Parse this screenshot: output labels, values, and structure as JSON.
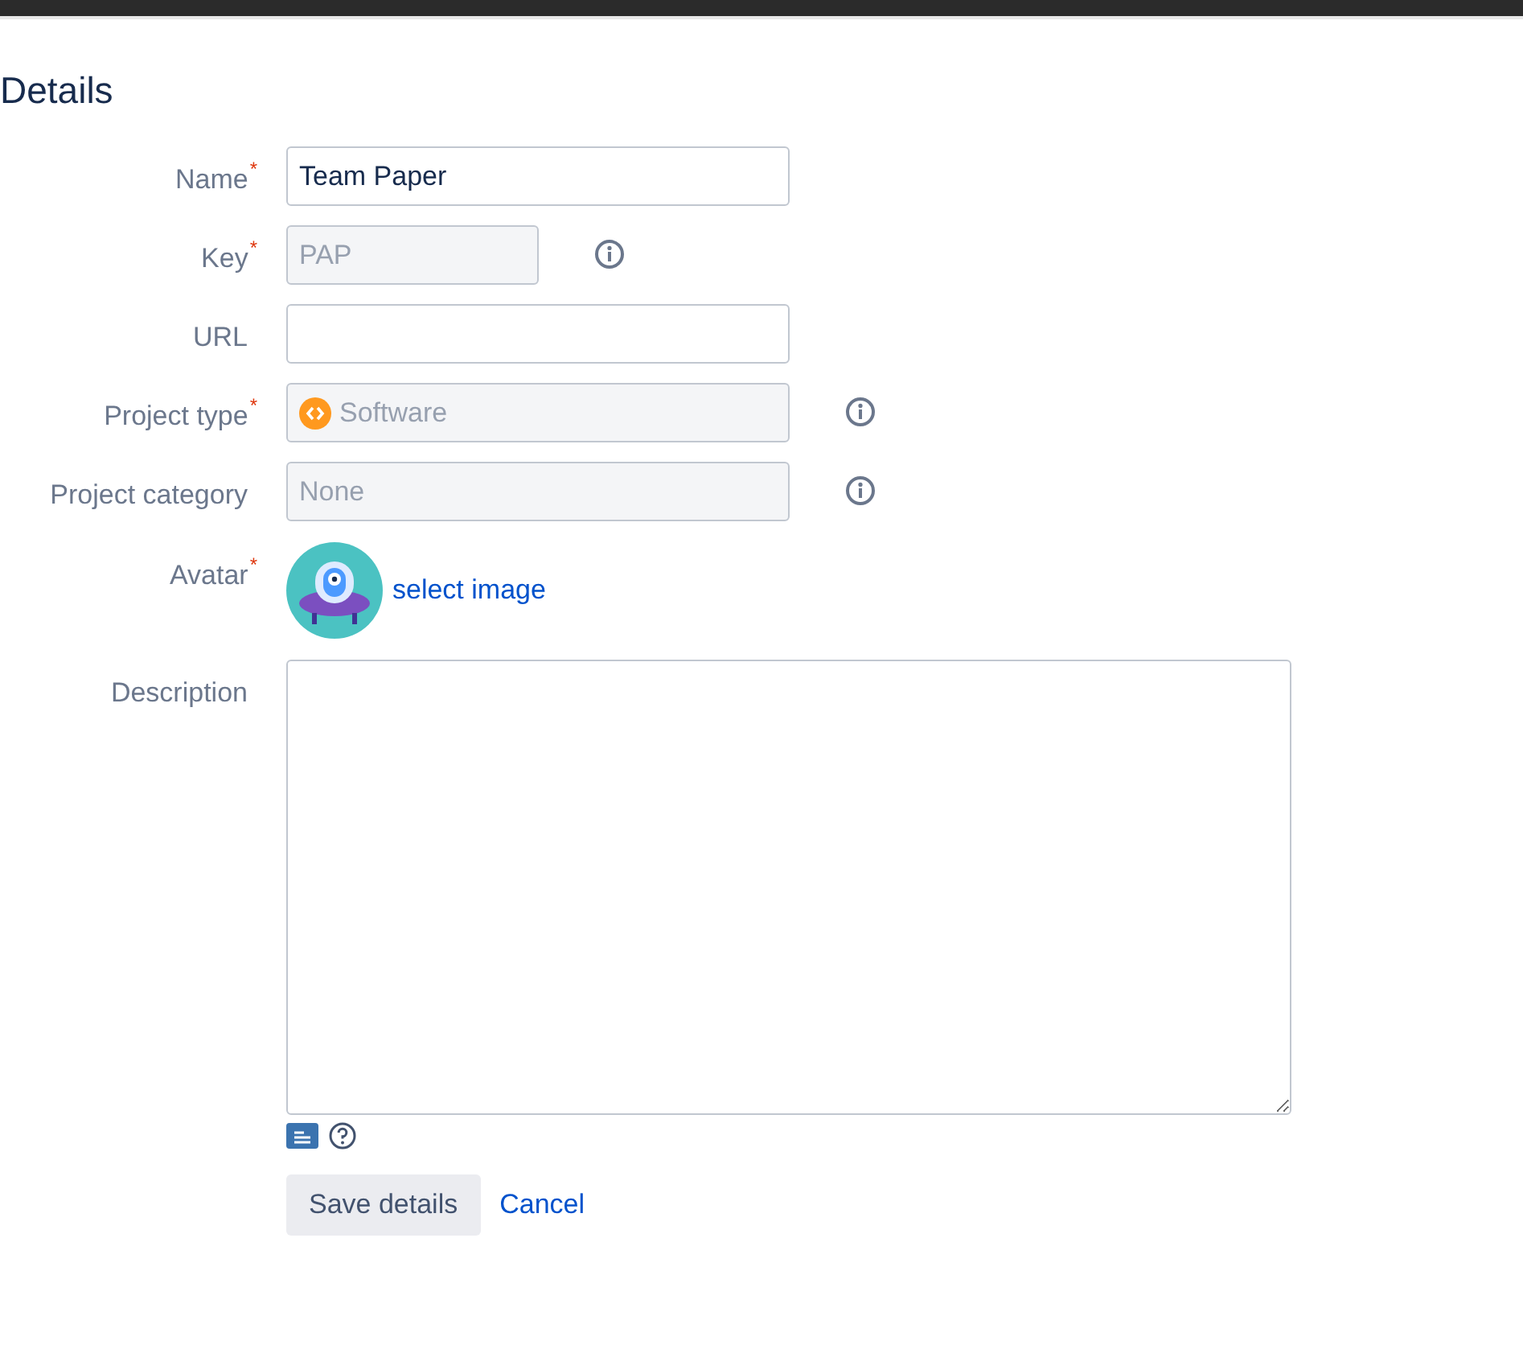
{
  "heading": "Details",
  "fields": [
    {
      "kind": "text",
      "label": "Name",
      "required_mark": "*",
      "value": "Team Paper",
      "disabled": false
    },
    {
      "kind": "short",
      "label": "Key",
      "required_mark": "*",
      "value": "PAP",
      "disabled": true,
      "info": true
    },
    {
      "kind": "text",
      "label": "URL"
    },
    {
      "kind": "type",
      "label": "Project type",
      "required_mark": "*",
      "value": "Software",
      "disabled": true,
      "info": true
    },
    {
      "kind": "text",
      "label": "Project category",
      "value": "None",
      "disabled": true,
      "info": true
    },
    {
      "kind": "avatar",
      "label": "Avatar",
      "required_mark": "*",
      "link": "select image"
    },
    {
      "kind": "textarea",
      "label": "Description"
    }
  ],
  "buttons": [
    {
      "kind": "primary",
      "label": "Save details"
    },
    {
      "kind": "link",
      "label": "Cancel"
    }
  ]
}
